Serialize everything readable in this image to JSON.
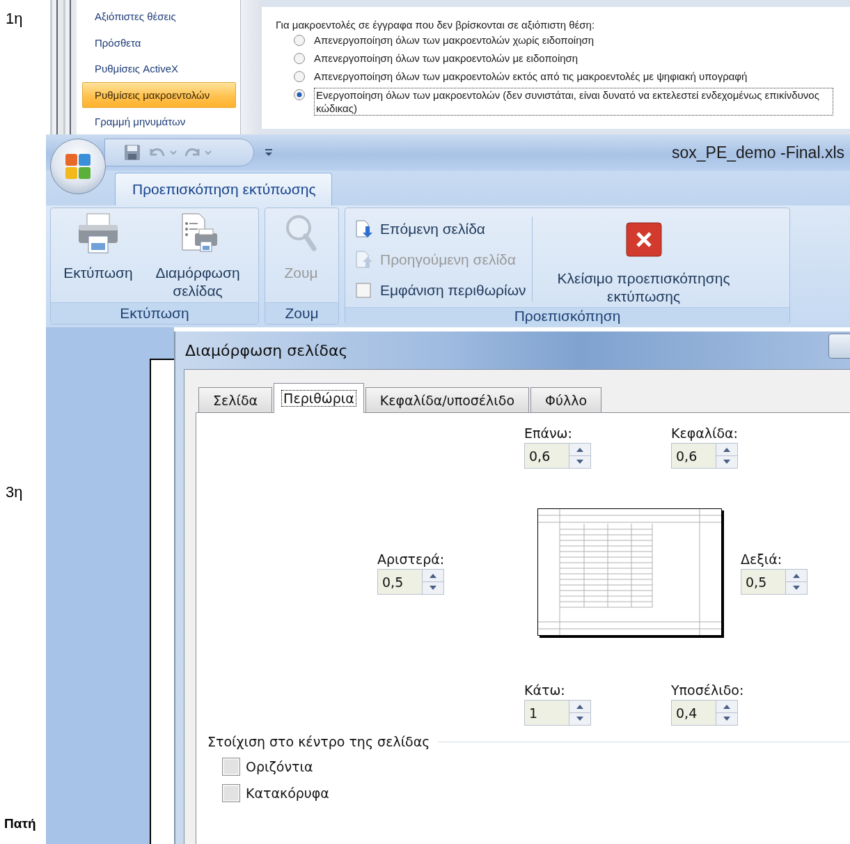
{
  "document_labels": [
    "1η",
    "3η",
    "Πατή"
  ],
  "trust_center": {
    "nav": [
      {
        "label": "Αξιόπιστες θέσεις",
        "selected": false
      },
      {
        "label": "Πρόσθετα",
        "selected": false
      },
      {
        "label": "Ρυθμίσεις ActiveX",
        "selected": false
      },
      {
        "label": "Ρυθμίσεις μακροεντολών",
        "selected": true
      },
      {
        "label": "Γραμμή μηνυμάτων",
        "selected": false
      }
    ],
    "heading": "Για μακροεντολές σε έγγραφα που δεν βρίσκονται σε αξιόπιστη θέση:",
    "options": [
      {
        "label": "Απενεργοποίηση όλων των μακροεντολών χωρίς ειδοποίηση",
        "selected": false
      },
      {
        "label": "Απενεργοποίηση όλων των μακροεντολών με ειδοποίηση",
        "selected": false
      },
      {
        "label": "Απενεργοποίηση όλων των μακροεντολών εκτός από τις μακροεντολές με ψηφιακή υπογραφή",
        "selected": false
      },
      {
        "label": "Ενεργοποίηση όλων των μακροεντολών (δεν συνιστάται, είναι δυνατό να εκτελεστεί ενδεχομένως επικίνδυνος κώδικας)",
        "selected": true
      }
    ]
  },
  "excel": {
    "title": "sox_PE_demo -Final.xls",
    "tabs": [
      {
        "label": "Προεπισκόπηση εκτύπωσης",
        "selected": true
      }
    ],
    "groups": [
      {
        "label": "Εκτύπωση",
        "items": [
          {
            "kind": "print",
            "label": "Εκτύπωση",
            "disabled": false
          },
          {
            "kind": "page-setup",
            "label": "Διαμόρφωση σελίδας",
            "disabled": false
          }
        ]
      },
      {
        "label": "Ζουμ",
        "items": [
          {
            "kind": "zoom",
            "label": "Ζουμ",
            "disabled": true
          }
        ]
      },
      {
        "label": "Προεπισκόπηση",
        "items": [
          {
            "kind": "next",
            "label": "Επόμενη σελίδα",
            "disabled": false
          },
          {
            "kind": "previous",
            "label": "Προηγούμενη σελίδα",
            "disabled": true
          },
          {
            "kind": "checkbox",
            "label": "Εμφάνιση περιθωρίων",
            "checked": false
          },
          {
            "kind": "close",
            "label": "Κλείσιμο προεπισκόπησης εκτύπωσης",
            "disabled": false
          }
        ]
      }
    ]
  },
  "dialog": {
    "title": "Διαμόρφωση σελίδας",
    "tabs": [
      {
        "label": "Σελίδα",
        "selected": false
      },
      {
        "label": "Περιθώρια",
        "selected": true
      },
      {
        "label": "Κεφαλίδα/υποσέλιδο",
        "selected": false
      },
      {
        "label": "Φύλλο",
        "selected": false
      }
    ],
    "fields": [
      {
        "label": "Επάνω:",
        "value": "0,6"
      },
      {
        "label": "Κεφαλίδα:",
        "value": "0,6"
      },
      {
        "label": "Αριστερά:",
        "value": "0,5"
      },
      {
        "label": "Δεξιά:",
        "value": "0,5"
      },
      {
        "label": "Κάτω:",
        "value": "1"
      },
      {
        "label": "Υποσέλιδο:",
        "value": "0,4"
      }
    ],
    "center": {
      "title": "Στοίχιση στο κέντρο της σελίδας",
      "options": [
        {
          "label": "Οριζόντια",
          "checked": false
        },
        {
          "label": "Κατακόρυφα",
          "checked": false
        }
      ]
    }
  }
}
